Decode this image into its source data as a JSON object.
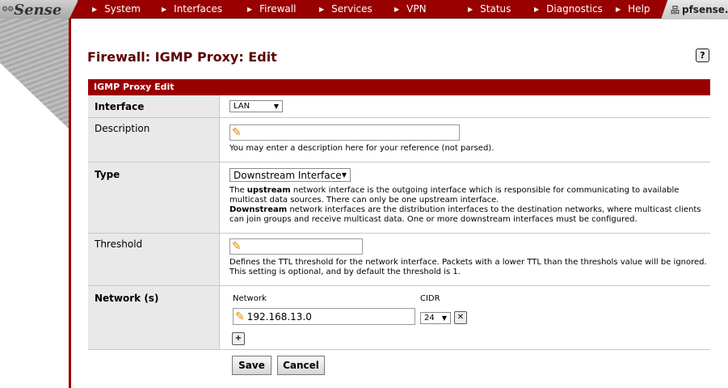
{
  "header": {
    "logo_text": "Sense",
    "menu": [
      "System",
      "Interfaces",
      "Firewall",
      "Services",
      "VPN",
      "Status",
      "Diagnostics",
      "Help"
    ],
    "hostname": "pfsense."
  },
  "page": {
    "title": "Firewall: IGMP Proxy: Edit",
    "help_icon": "?"
  },
  "form": {
    "section_title": "IGMP Proxy Edit",
    "interface": {
      "label": "Interface",
      "value": "LAN"
    },
    "description": {
      "label": "Description",
      "value": "",
      "help": "You may enter a description here for your reference (not parsed)."
    },
    "type": {
      "label": "Type",
      "value": "Downstream Interface",
      "help_upstream_term": "upstream",
      "help_upstream_text": " network interface is the outgoing interface which is responsible for communicating to available multicast data sources. There can only be one upstream interface.",
      "help_downstream_term": "Downstream",
      "help_downstream_text": " network interfaces are the distribution interfaces to the destination networks, where multicast clients can join groups and receive multicast data. One or more downstream interfaces must be configured.",
      "help_prefix": "The "
    },
    "threshold": {
      "label": "Threshold",
      "value": "",
      "help": "Defines the TTL threshold for the network interface. Packets with a lower TTL than the threshols value will be ignored. This setting is optional, and by default the threshold is 1."
    },
    "networks": {
      "label": "Network (s)",
      "col_network": "Network",
      "col_cidr": "CIDR",
      "rows": [
        {
          "network": "192.168.13.0",
          "cidr": "24"
        }
      ]
    },
    "save_label": "Save",
    "cancel_label": "Cancel"
  }
}
